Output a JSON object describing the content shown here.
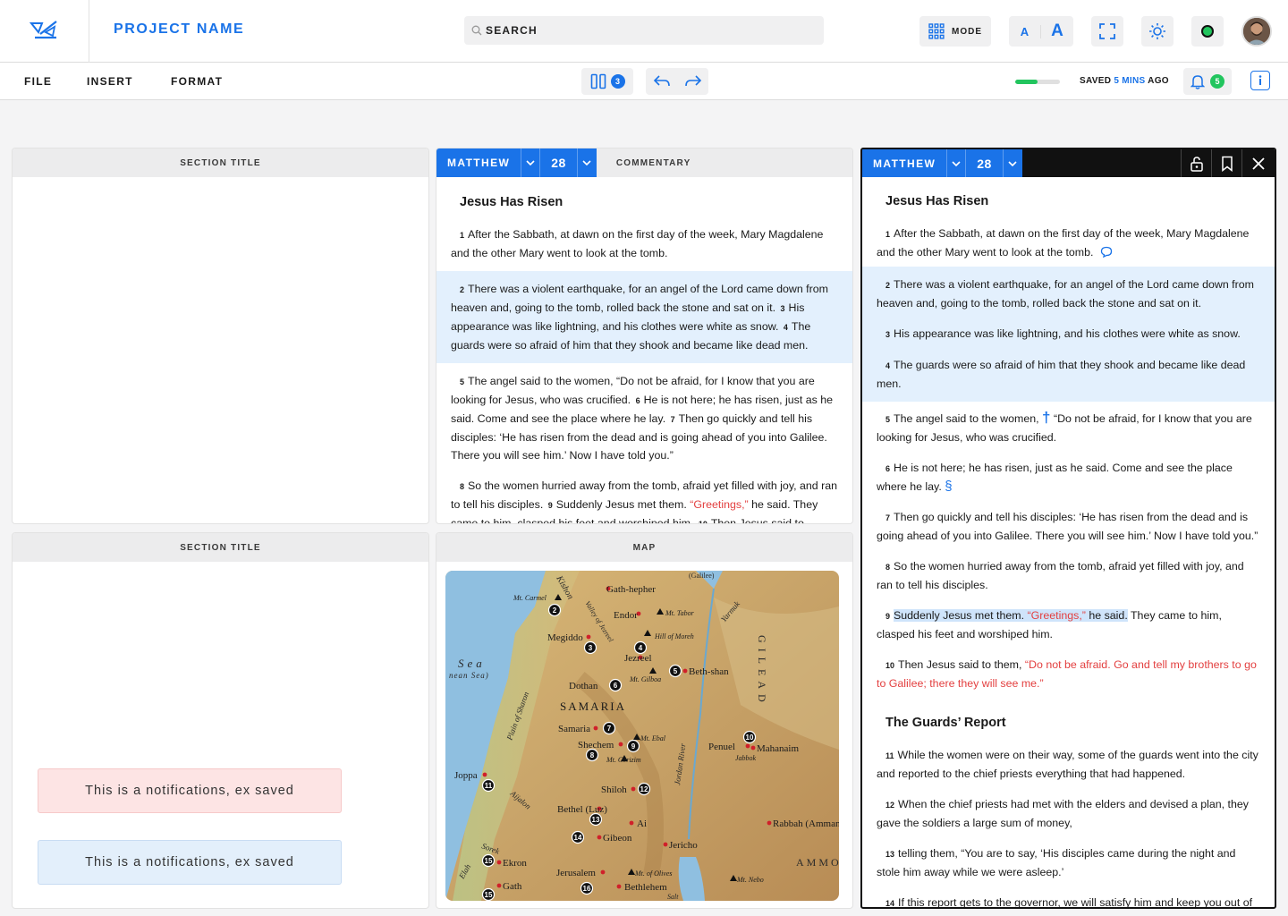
{
  "header": {
    "project_name": "PROJECT NAME",
    "search_placeholder": "SEARCH",
    "mode_label": "MODE",
    "font_small": "A",
    "font_large": "A"
  },
  "menu": {
    "items": [
      "FILE",
      "INSERT",
      "FORMAT"
    ],
    "columns_count": "3",
    "progress_percent": 50,
    "saved_prefix": "SAVED",
    "saved_time": "5 MINS",
    "saved_suffix": "AGO",
    "notifications_count": "5"
  },
  "colors": {
    "accent": "#1a73e8",
    "success": "#22c55e",
    "highlight": "#e3f0fd",
    "red_letter": "#e34040"
  },
  "panels": {
    "left_top_title": "SECTION TITLE",
    "left_bottom_title": "SECTION TITLE",
    "map_title": "MAP",
    "commentary_label": "COMMENTARY"
  },
  "notifications": {
    "error": "This is a notifications, ex saved",
    "info": "This is a notifications, ex saved"
  },
  "middle_reader": {
    "book": "MATTHEW",
    "chapter": "28",
    "heading": "Jesus Has Risen",
    "v1": "After the Sabbath, at dawn on the first day of the week, Mary Magdalene and the other Mary went to look at the tomb.",
    "v2": "There was a violent earthquake, for an angel of the Lord came down from heaven and, going to the tomb, rolled back the stone and sat on it.",
    "v3": "His appearance was like lightning, and his clothes were white as snow.",
    "v4": "The guards were so afraid of him that they shook and became like dead men.",
    "v5": "The angel said to the women, “Do not be afraid, for I know that you are looking for Jesus, who was crucified.",
    "v6": "He is not here; he has risen, just as he said. Come and see the place where he lay.",
    "v7": "Then go quickly and tell his disciples: ‘He has risen from the dead and is going ahead of you into Galilee. There you will see him.’ Now I have told you.”",
    "v8": "So the women hurried away from the tomb, afraid yet filled with joy, and ran to tell his disciples.",
    "v9a": "Suddenly Jesus met them.",
    "v9red": "“Greetings,”",
    "v9b": "he said. They came to him, clasped his feet and worshiped him.",
    "v10": "Then Jesus said to"
  },
  "right_reader": {
    "book": "MATTHEW",
    "chapter": "28",
    "heading": "Jesus Has Risen",
    "v1": "After the Sabbath, at dawn on the first day of the week, Mary Magdalene and the other Mary went to look at the tomb.",
    "v2": "There was a violent earthquake, for an angel of the Lord came down from heaven and, going to the tomb, rolled back the stone and sat on it.",
    "v3": "His appearance was like lightning, and his clothes were white as snow.",
    "v4": "The guards were so afraid of him that they shook and became like dead men.",
    "v5a": "The angel said to the women,",
    "v5b": "“Do not be afraid, for I know that you are looking for Jesus, who was crucified.",
    "v6": "He is not here; he has risen, just as he said. Come and see the place where he lay.",
    "v7": "Then go quickly and tell his disciples: ‘He has risen from the dead and is going ahead of you into Galilee. There you will see him.’ Now I have told you.”",
    "v8": "So the women hurried away from the tomb, afraid yet filled with joy, and ran to tell his disciples.",
    "v9a": "Suddenly Jesus met them.",
    "v9red": "“Greetings,”",
    "v9b": "he said.",
    "v9c": "They came to him, clasped his feet and worshiped him.",
    "v10a": "Then Jesus said to them,",
    "v10red": "“Do not be afraid. Go and tell my brothers to go to Galilee; there they will see me.”",
    "heading2": "The Guards’ Report",
    "v11": "While the women were on their way, some of the guards went into the city and reported to the chief priests everything that had happened.",
    "v12": "When the chief priests had met with the elders and devised a plan, they gave the soldiers a large sum of money,",
    "v13": "telling them, “You are to say, ‘His disciples came during the night and stole him away while we were asleep.’",
    "v14": "If this report gets to the governor, we will satisfy him and keep you out of trouble.”",
    "cross_symbol": "†",
    "section_symbol": "§"
  },
  "map": {
    "places": [
      {
        "name": "Gath-hepher",
        "num": ""
      },
      {
        "name": "Mt. Carmel",
        "num": "2"
      },
      {
        "name": "Endor",
        "num": ""
      },
      {
        "name": "Mt. Tabor",
        "num": ""
      },
      {
        "name": "Megiddo",
        "num": "3"
      },
      {
        "name": "Hill of Moreh",
        "num": "4"
      },
      {
        "name": "Jezreel",
        "num": ""
      },
      {
        "name": "Beth-shan",
        "num": "5"
      },
      {
        "name": "Mt. Gilboa",
        "num": ""
      },
      {
        "name": "Dothan",
        "num": "6"
      },
      {
        "name": "SAMARIA",
        "num": ""
      },
      {
        "name": "Samaria",
        "num": "7"
      },
      {
        "name": "Mt. Ebal",
        "num": ""
      },
      {
        "name": "Shechem",
        "num": "9"
      },
      {
        "name": "Mt. Gerizim",
        "num": "8"
      },
      {
        "name": "Penuel",
        "num": "10"
      },
      {
        "name": "Mahanaim",
        "num": ""
      },
      {
        "name": "Jabbok",
        "num": ""
      },
      {
        "name": "Joppa",
        "num": "11"
      },
      {
        "name": "Shiloh",
        "num": "12"
      },
      {
        "name": "Bethel (Luz)",
        "num": "13"
      },
      {
        "name": "Ai",
        "num": ""
      },
      {
        "name": "Gibeon",
        "num": "14"
      },
      {
        "name": "Jericho",
        "num": ""
      },
      {
        "name": "Rabbah (Amman)",
        "num": ""
      },
      {
        "name": "Ekron",
        "num": "15"
      },
      {
        "name": "Jerusalem",
        "num": ""
      },
      {
        "name": "Mt. of Olives",
        "num": ""
      },
      {
        "name": "Gath",
        "num": "15"
      },
      {
        "name": "Bethlehem",
        "num": "16"
      },
      {
        "name": "Mt. Nebo",
        "num": ""
      }
    ],
    "labels": {
      "sea": "Sea",
      "sea_sub": "nean Sea)",
      "galilee": "(Galilee)",
      "kishon": "Kishon",
      "valley": "Valley of Jezreel",
      "yarmuk": "Yarmuk",
      "gilead": "GILEAD",
      "sharon": "Plain of Sharon",
      "jordan": "Jordan River",
      "aijalon": "Aijalon",
      "sorek": "Sorek",
      "elah": "Elah",
      "salt": "Salt",
      "ammon": "AMMO"
    }
  }
}
